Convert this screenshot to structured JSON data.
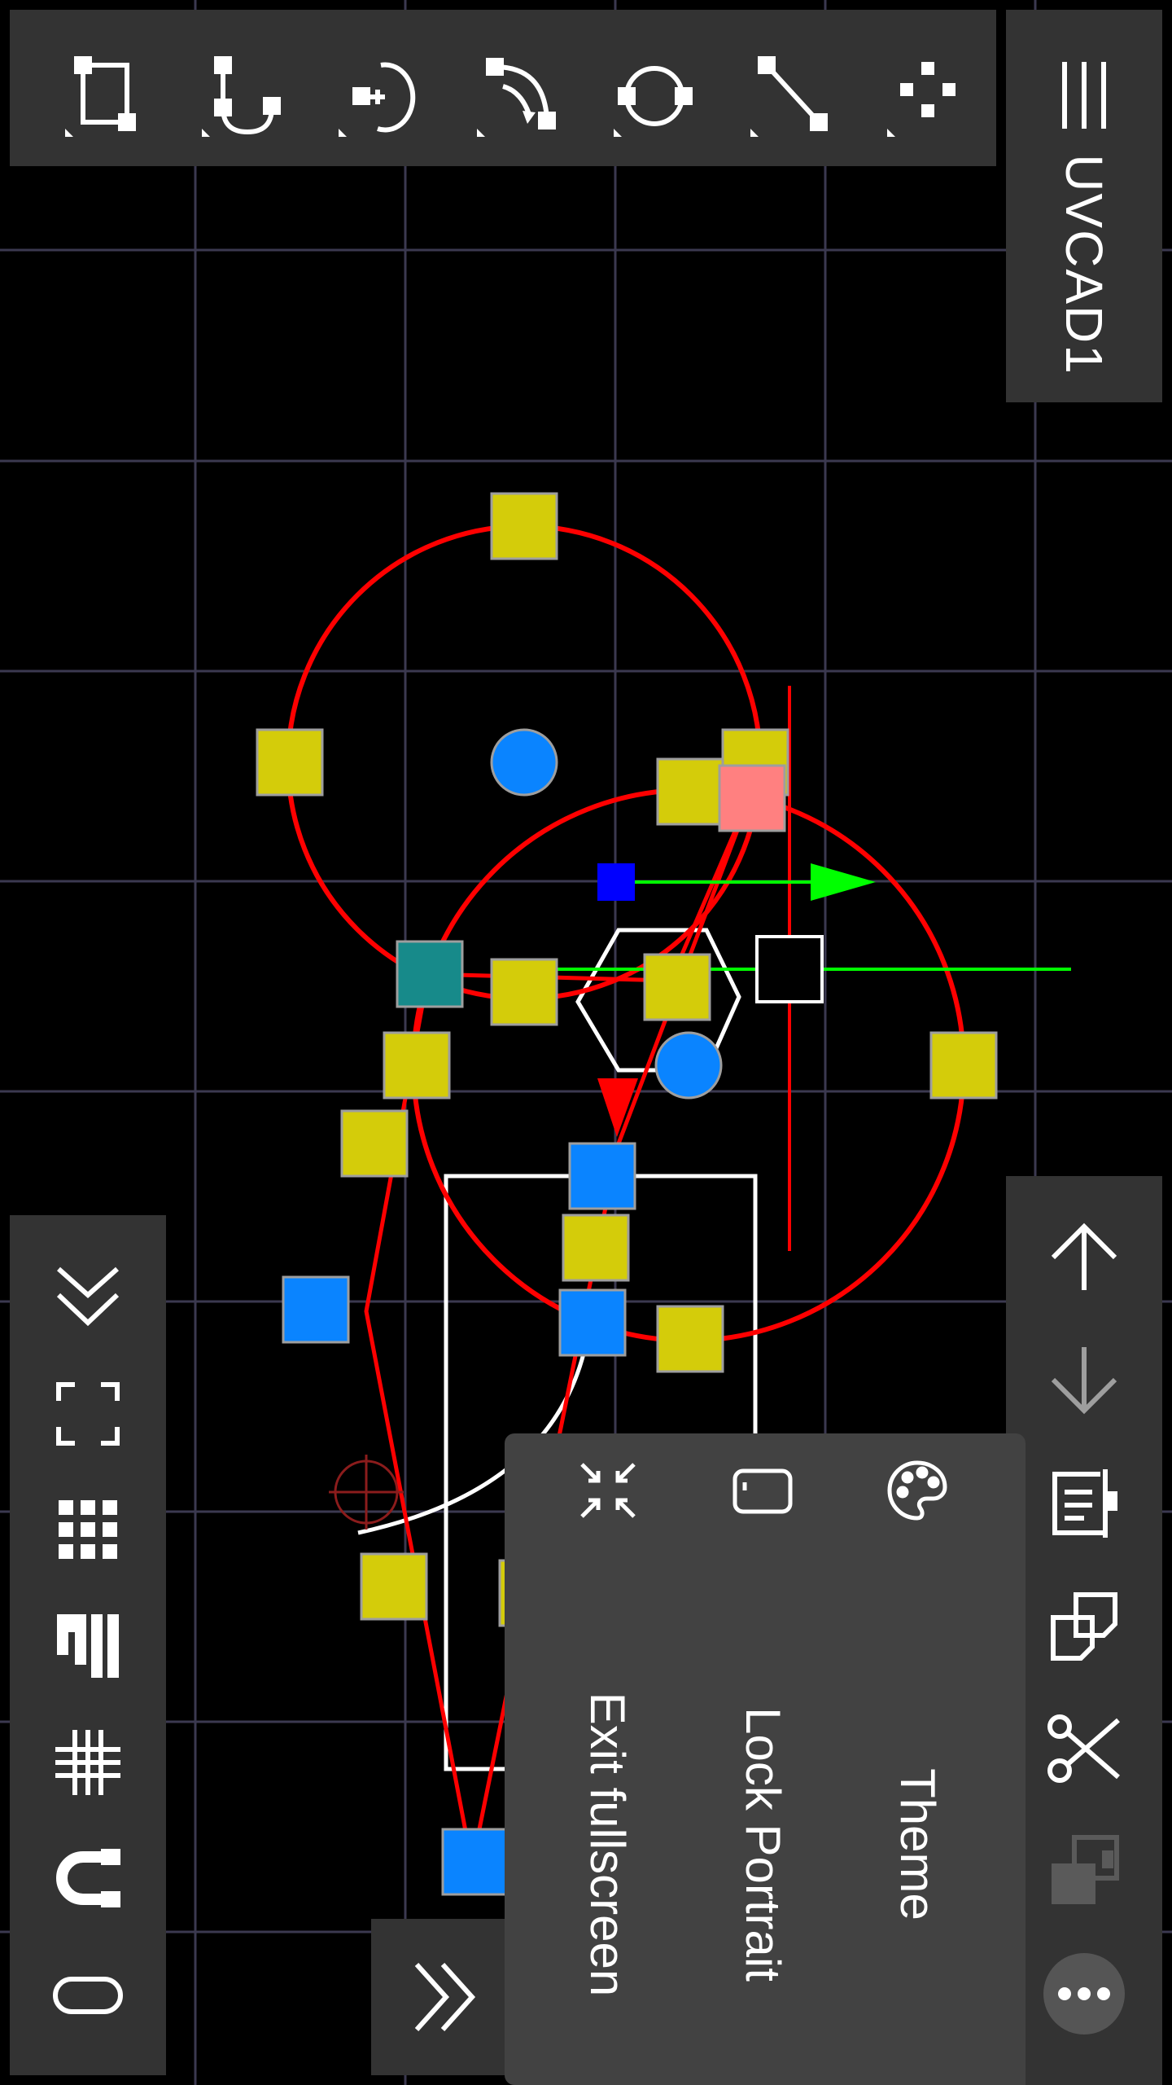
{
  "app": {
    "title": "UVCAD1"
  },
  "colors": {
    "background": "#000000",
    "grid": "#3b3950",
    "panel": "#333333",
    "menu": "#424242",
    "icon": "#ffffff",
    "disabled_icon": "#9e9e9e",
    "curve_red": "#ff0000",
    "handle_yellow": "#d4cc0a",
    "handle_blue": "#0a84ff",
    "handle_teal": "#178a8a",
    "handle_pink": "#ff8080",
    "axis_green": "#00ff00"
  },
  "top_toolbar": {
    "tools": [
      {
        "icon": "rectangle-tool-icon"
      },
      {
        "icon": "arc-tool-icon"
      },
      {
        "icon": "circle-add-point-icon"
      },
      {
        "icon": "rotate-tool-icon"
      },
      {
        "icon": "circle-tool-icon"
      },
      {
        "icon": "line-tool-icon"
      },
      {
        "icon": "points-tool-icon"
      }
    ]
  },
  "right_top_panel": {
    "menu_icon": "hamburger-menu-icon",
    "title": "UVCAD1"
  },
  "right_bottom_toolbar": {
    "tools": [
      {
        "icon": "move-up-icon",
        "enabled": true
      },
      {
        "icon": "move-down-icon",
        "enabled": false
      },
      {
        "icon": "properties-icon",
        "enabled": true
      },
      {
        "icon": "copy-icon",
        "enabled": true
      },
      {
        "icon": "cut-icon",
        "enabled": true
      },
      {
        "icon": "paste-icon",
        "enabled": false
      },
      {
        "icon": "more-options-icon",
        "enabled": true
      }
    ]
  },
  "left_toolbar": {
    "tools": [
      {
        "icon": "collapse-chevrons-icon"
      },
      {
        "icon": "fit-view-icon"
      },
      {
        "icon": "grid-dots-icon"
      },
      {
        "icon": "snap-points-icon"
      },
      {
        "icon": "grid-lines-icon"
      },
      {
        "icon": "magnet-snap-icon"
      },
      {
        "icon": "shape-rounded-rect-icon"
      }
    ]
  },
  "expand_button": {
    "icon": "expand-chevrons-icon"
  },
  "context_menu": {
    "items": [
      {
        "label": "Theme",
        "icon": "palette-icon"
      },
      {
        "label": "Lock Portrait",
        "icon": "screen-rotation-icon"
      },
      {
        "label": "Exit fullscreen",
        "icon": "exit-fullscreen-icon"
      }
    ]
  }
}
